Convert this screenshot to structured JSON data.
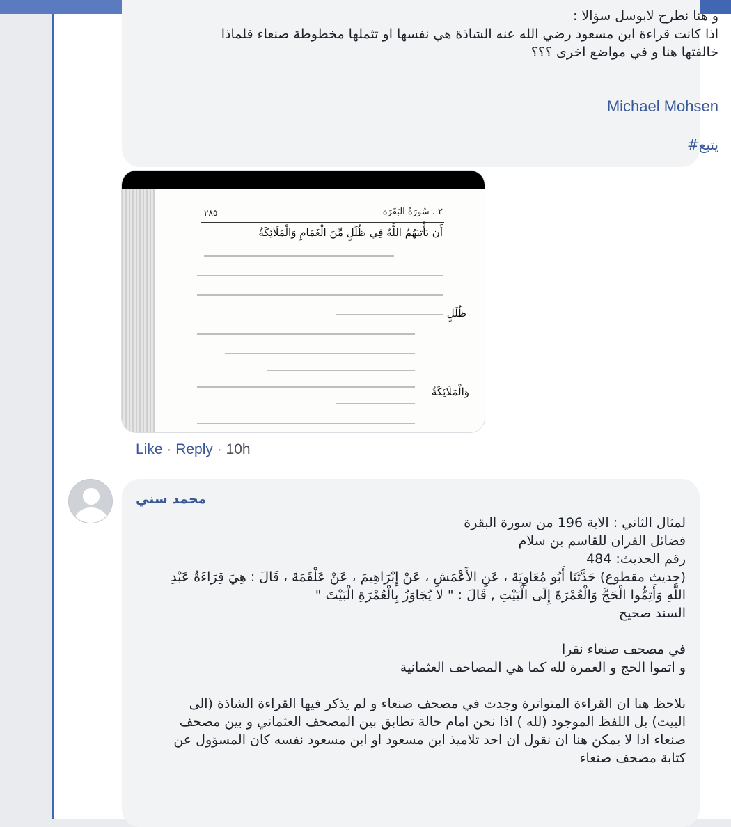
{
  "comment1": {
    "lines": [
      "و  هنا نطرح لابوسل سؤالا :",
      "اذا كانت قراءة ابن مسعود رضي الله عنه الشاذة هي نفسها او تثملها مخطوطة صنعاء فلماذا",
      "خالفتها هنا و في مواضع اخرى ؟؟؟"
    ],
    "mention": "Michael Mohsen",
    "hashtag": "#يتبع"
  },
  "attachment": {
    "page_number": "٢٨٥",
    "surah_header": "٢ . سُورَةُ البَقَرَة",
    "verse": "أَن يَأْتِيَهُمُ اللَّهُ فِي ظُلَلٍ مِّنَ الْغَمَامِ وَالْمَلَائِكَةُ",
    "word1": "ظُلَلٍ",
    "word2": "وَالْمَلَائِكَةُ"
  },
  "actions": {
    "like": "Like",
    "sep": " · ",
    "reply": "Reply",
    "time": "10h"
  },
  "comment2": {
    "author": "محمد سني",
    "lines": [
      "لمثال الثاني : الاية 196 من سورة البقرة",
      "فضائل القران للقاسم بن سلام",
      "رقم الحديث: 484",
      "(حديث مقطوع) حَدَّثَنَا أَبُو مُعَاوِيَةَ ، عَنِ الأَعْمَشِ ، عَنْ إِبْرَاهِيمَ ، عَنْ عَلْقَمَةَ ، قَالَ : هِيَ قِرَاءَةُ عَبْدِ",
      "اللَّهِ وَأَتِمُّوا الْحَجَّ وَالْعُمْرَةَ إِلَى الْبَيْتِ , قَالَ : \" لا يُجَاوَزُ بِالْعُمْرَةِ الْبَيْتَ \"",
      "السند صحيح"
    ],
    "lines2": [
      "في مصحف صنعاء نقرا",
      "و اتموا الحج و العمرة لله كما هي المصاحف العثمانية"
    ],
    "lines3": [
      "نلاحظ هنا ان القراءة المتواترة وجدت في مصحف صنعاء و لم يذكر فيها القراءة الشاذة (الى",
      "البيت) بل اللفظ الموجود (لله ) اذا نحن امام حالة تطابق بين المصحف العثماني و بين مصحف",
      "صنعاء اذا لا يمكن هنا ان نقول ان احد تلاميذ ابن مسعود او ابن مسعود نفسه كان المسؤول عن",
      "كتابة مصحف صنعاء"
    ]
  }
}
